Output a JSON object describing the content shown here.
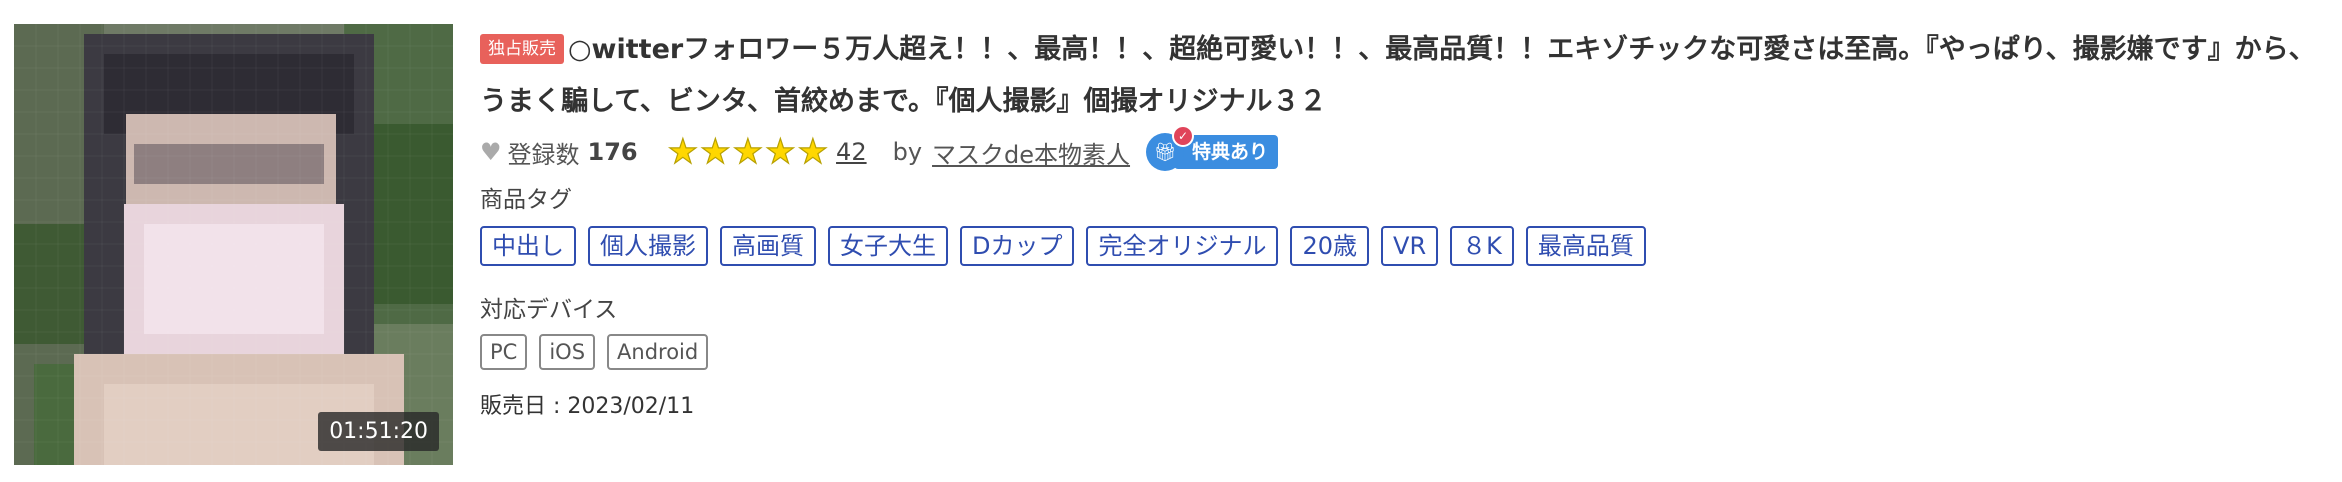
{
  "thumbnail": {
    "duration": "01:51:20"
  },
  "product": {
    "badge": "独占販売",
    "title": "○witterフォロワー５万人超え！！、最高！！、超絶可愛い！！、最高品質！！エキゾチックな可愛さは至高。『やっぱり、撮影嫌です』から、うまく騙して、ビンタ、首絞めまで。『個人撮影』個撮オリジナル３２"
  },
  "meta": {
    "registered_label": "登録数",
    "registered_count": "176",
    "rating_stars": 5,
    "review_count": "42",
    "by_label": "by",
    "author": "マスクde本物素人",
    "perk_icon": "gift-icon",
    "perk_label": "特典あり"
  },
  "tags_section": {
    "label": "商品タグ",
    "tags": [
      "中出し",
      "個人撮影",
      "高画質",
      "女子大生",
      "Dカップ",
      "完全オリジナル",
      "20歳",
      "VR",
      "８K",
      "最高品質"
    ]
  },
  "devices_section": {
    "label": "対応デバイス",
    "devices": [
      "PC",
      "iOS",
      "Android"
    ]
  },
  "release": {
    "text": "販売日 : 2023/02/11"
  },
  "colors": {
    "badge": "#e8615b",
    "tag_border": "#2f4db0",
    "star": "#ffd700",
    "perk": "#3b8de0"
  }
}
